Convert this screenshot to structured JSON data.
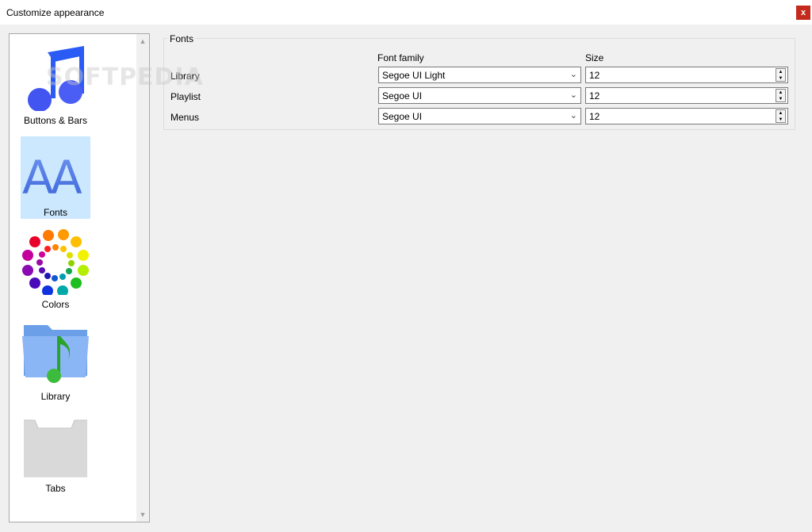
{
  "window": {
    "title": "Customize appearance",
    "close_label": "x"
  },
  "sidebar": {
    "items": [
      {
        "label": "Buttons & Bars",
        "icon": "music-note-icon",
        "selected": false
      },
      {
        "label": "Fonts",
        "icon": "font-aa-icon",
        "selected": true
      },
      {
        "label": "Colors",
        "icon": "color-wheel-icon",
        "selected": false
      },
      {
        "label": "Library",
        "icon": "music-folder-icon",
        "selected": false
      },
      {
        "label": "Tabs",
        "icon": "tab-folder-icon",
        "selected": false
      }
    ],
    "selected_color": "#cce8ff"
  },
  "fonts_group": {
    "title": "Fonts",
    "col_font_family": "Font family",
    "col_size": "Size",
    "rows": [
      {
        "label": "Library",
        "font": "Segoe UI Light",
        "size": "12"
      },
      {
        "label": "Playlist",
        "font": "Segoe UI",
        "size": "12"
      },
      {
        "label": "Menus",
        "font": "Segoe UI",
        "size": "12"
      }
    ]
  },
  "watermark": "SOFTPEDIA"
}
